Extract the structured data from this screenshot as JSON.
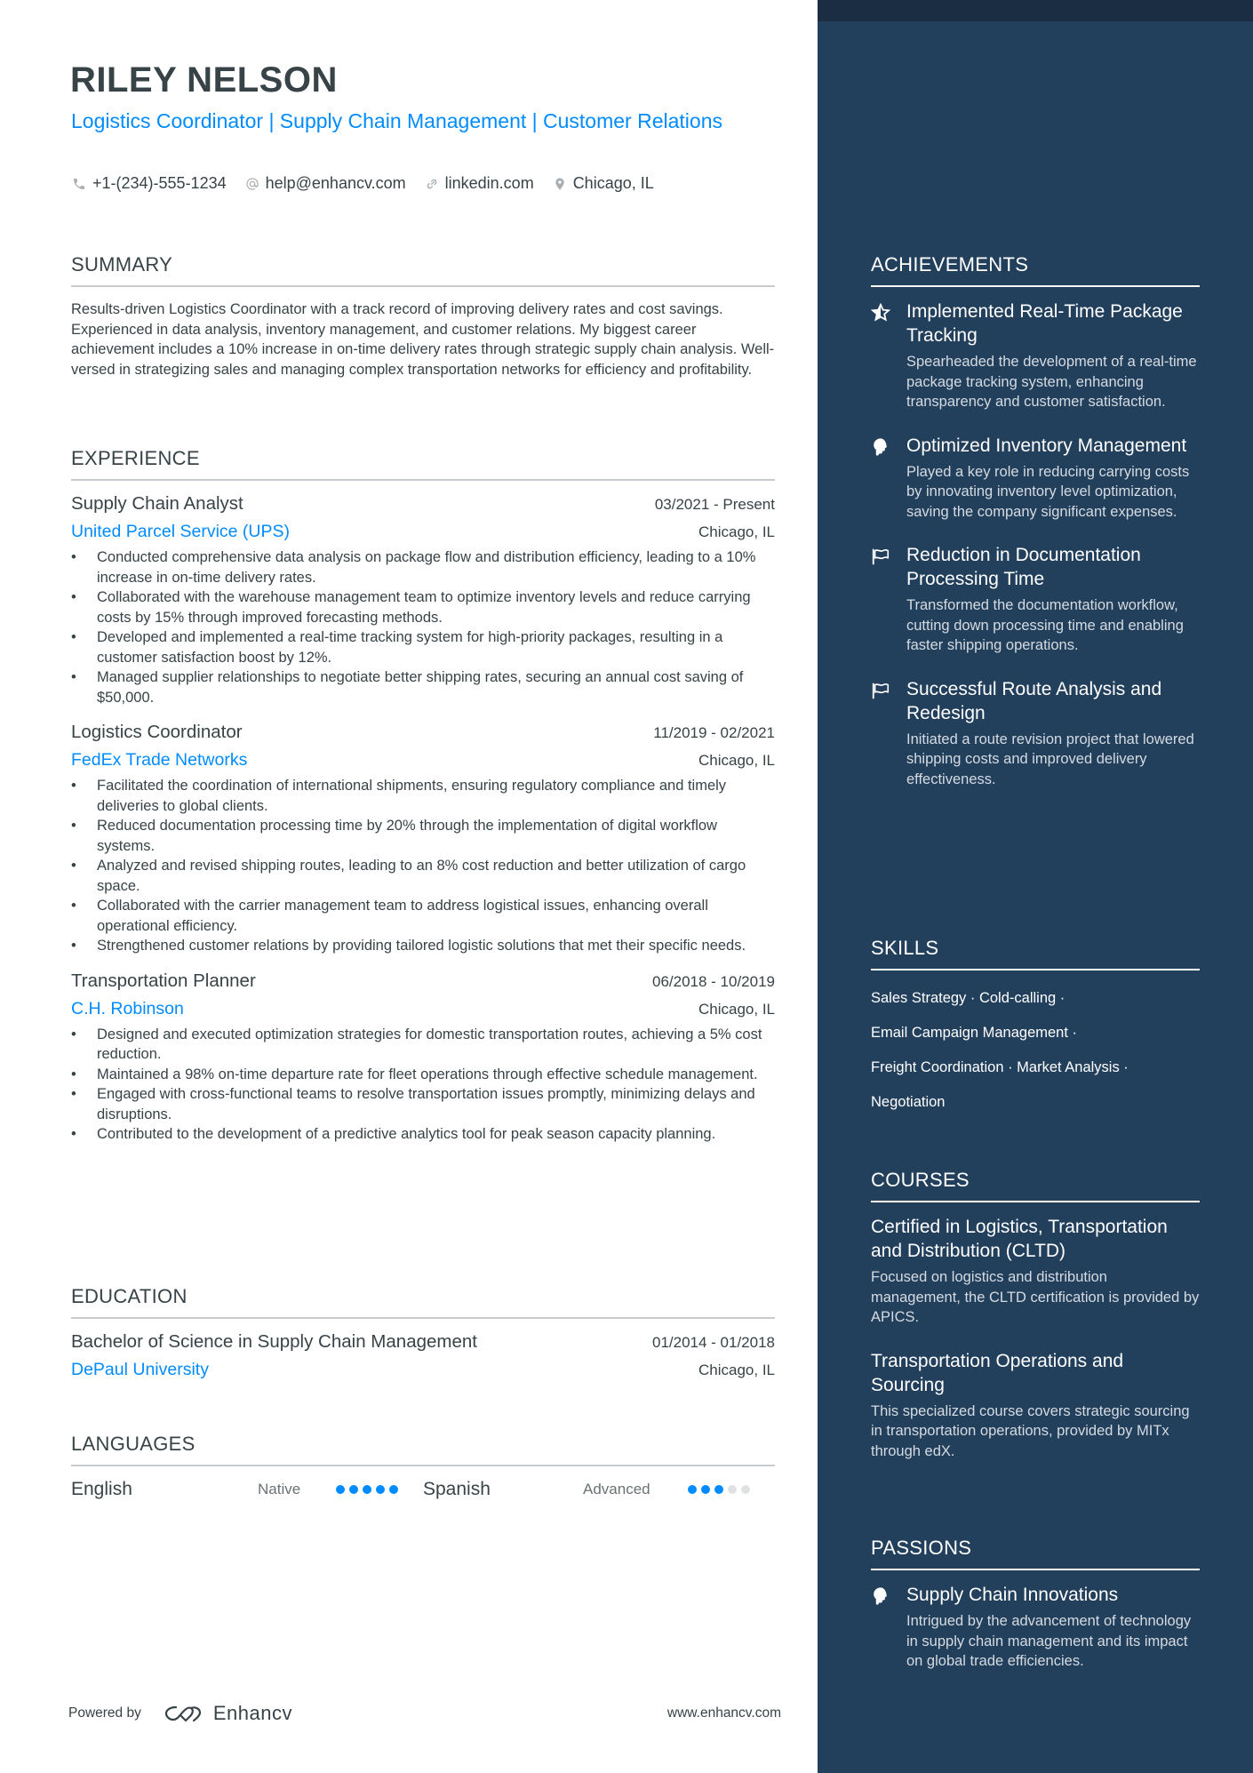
{
  "header": {
    "name": "RILEY NELSON",
    "headline": "Logistics Coordinator | Supply Chain Management | Customer Relations",
    "contacts": [
      {
        "icon": "phone-icon",
        "text": "+1-(234)-555-1234"
      },
      {
        "icon": "at-icon",
        "text": "help@enhancv.com"
      },
      {
        "icon": "link-icon",
        "text": "linkedin.com"
      },
      {
        "icon": "location-pin-icon",
        "text": "Chicago, IL"
      }
    ]
  },
  "summary": {
    "title": "SUMMARY",
    "text": "Results-driven Logistics Coordinator with a track record of improving delivery rates and cost savings. Experienced in data analysis, inventory management, and customer relations. My biggest career achievement includes a 10% increase in on-time delivery rates through strategic supply chain analysis. Well-versed in strategizing sales and managing complex transportation networks for efficiency and profitability."
  },
  "experience": {
    "title": "EXPERIENCE",
    "jobs": [
      {
        "title": "Supply Chain Analyst",
        "dates": "03/2021 - Present",
        "company": "United Parcel Service (UPS)",
        "location": "Chicago, IL",
        "bullets": [
          "Conducted comprehensive data analysis on package flow and distribution efficiency, leading to a 10% increase in on-time delivery rates.",
          "Collaborated with the warehouse management team to optimize inventory levels and reduce carrying costs by 15% through improved forecasting methods.",
          "Developed and implemented a real-time tracking system for high-priority packages, resulting in a customer satisfaction boost by 12%.",
          "Managed supplier relationships to negotiate better shipping rates, securing an annual cost saving of $50,000."
        ]
      },
      {
        "title": "Logistics Coordinator",
        "dates": "11/2019 - 02/2021",
        "company": "FedEx Trade Networks",
        "location": "Chicago, IL",
        "bullets": [
          "Facilitated the coordination of international shipments, ensuring regulatory compliance and timely deliveries to global clients.",
          "Reduced documentation processing time by 20% through the implementation of digital workflow systems.",
          "Analyzed and revised shipping routes, leading to an 8% cost reduction and better utilization of cargo space.",
          "Collaborated with the carrier management team to address logistical issues, enhancing overall operational efficiency.",
          "Strengthened customer relations by providing tailored logistic solutions that met their specific needs."
        ]
      },
      {
        "title": "Transportation Planner",
        "dates": "06/2018 - 10/2019",
        "company": "C.H. Robinson",
        "location": "Chicago, IL",
        "bullets": [
          "Designed and executed optimization strategies for domestic transportation routes, achieving a 5% cost reduction.",
          "Maintained a 98% on-time departure rate for fleet operations through effective schedule management.",
          "Engaged with cross-functional teams to resolve transportation issues promptly, minimizing delays and disruptions.",
          "Contributed to the development of a predictive analytics tool for peak season capacity planning."
        ]
      }
    ]
  },
  "education": {
    "title": "EDUCATION",
    "items": [
      {
        "degree": "Bachelor of Science in Supply Chain Management",
        "dates": "01/2014 - 01/2018",
        "school": "DePaul University",
        "location": "Chicago, IL"
      }
    ]
  },
  "languages": {
    "title": "LANGUAGES",
    "items": [
      {
        "name": "English",
        "level": "Native",
        "rating": 5,
        "max": 5
      },
      {
        "name": "Spanish",
        "level": "Advanced",
        "rating": 3,
        "max": 5
      }
    ]
  },
  "footer": {
    "powered_by": "Powered by",
    "brand": "Enhancv",
    "site": "www.enhancv.com"
  },
  "achievements": {
    "title": "ACHIEVEMENTS",
    "items": [
      {
        "icon": "star-icon",
        "title": "Implemented Real-Time Package Tracking",
        "desc": "Spearheaded the development of a real-time package tracking system, enhancing transparency and customer satisfaction."
      },
      {
        "icon": "brain-head-icon",
        "title": "Optimized Inventory Management",
        "desc": "Played a key role in reducing carrying costs by innovating inventory level optimization, saving the company significant expenses."
      },
      {
        "icon": "flag-icon",
        "title": "Reduction in Documentation Processing Time",
        "desc": "Transformed the documentation workflow, cutting down processing time and enabling faster shipping operations."
      },
      {
        "icon": "flag-icon",
        "title": "Successful Route Analysis and Redesign",
        "desc": "Initiated a route revision project that lowered shipping costs and improved delivery effectiveness."
      }
    ]
  },
  "skills": {
    "title": "SKILLS",
    "lines": [
      "Sales Strategy · Cold-calling ·",
      "Email Campaign Management ·",
      "Freight Coordination · Market Analysis ·",
      "Negotiation"
    ]
  },
  "courses": {
    "title": "COURSES",
    "items": [
      {
        "title": "Certified in Logistics, Transportation and Distribution (CLTD)",
        "desc": "Focused on logistics and distribution management, the CLTD certification is provided by APICS."
      },
      {
        "title": "Transportation Operations and Sourcing",
        "desc": "This specialized course covers strategic sourcing in transportation operations, provided by MITx through edX."
      }
    ]
  },
  "passions": {
    "title": "PASSIONS",
    "items": [
      {
        "icon": "brain-head-icon",
        "title": "Supply Chain Innovations",
        "desc": "Intrigued by the advancement of technology in supply chain management and its impact on global trade efficiencies."
      }
    ]
  },
  "colors": {
    "accent": "#008cff",
    "sidebar_bg": "#223f5c",
    "sidebar_top": "#1a2d43",
    "text": "#384347"
  }
}
